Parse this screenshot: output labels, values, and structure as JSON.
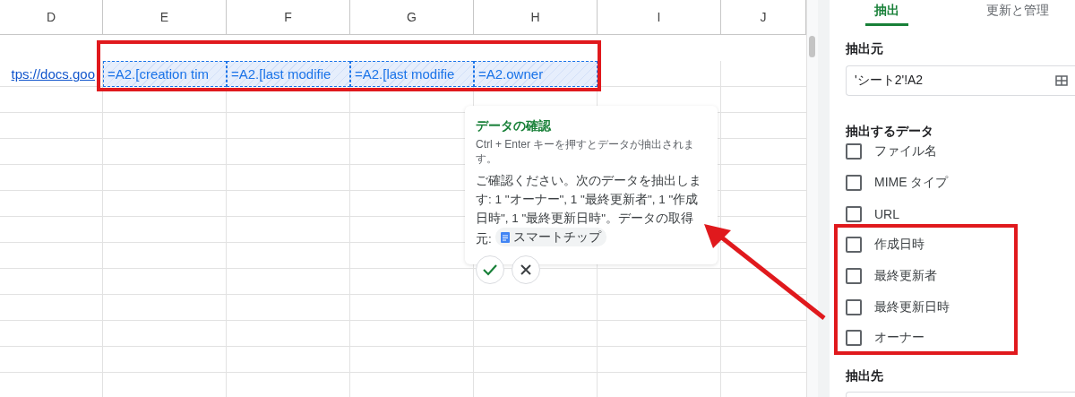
{
  "sheet": {
    "columns": [
      "D",
      "E",
      "F",
      "G",
      "H",
      "I",
      "J"
    ],
    "link_cell": "tps://docs.goo",
    "formula_cells": [
      {
        "text": "=A2.[creation tim",
        "selected": true
      },
      {
        "text": "=A2.[last modifie",
        "selected": true
      },
      {
        "text": "=A2.[last modifie",
        "selected": true
      },
      {
        "text": "=A2.owner",
        "selected": true
      }
    ]
  },
  "popup": {
    "title": "データの確認",
    "hint": "Ctrl + Enter キーを押すとデータが抽出されます。",
    "body": "ご確認ください。次のデータを抽出します: 1 \"オーナー\", 1 \"最終更新者\", 1 \"作成日時\", 1 \"最終更新日時\"。データの取得元:",
    "chip": "スマートチップ"
  },
  "panel": {
    "tabs": [
      {
        "label": "抽出",
        "selected": true
      },
      {
        "label": "更新と管理",
        "selected": false
      }
    ],
    "source_label": "抽出元",
    "source_value": "'シート2'!A2",
    "data_label": "抽出するデータ",
    "options": [
      {
        "label": "ファイル名",
        "checked": false
      },
      {
        "label": "MIME タイプ",
        "checked": false
      },
      {
        "label": "URL",
        "checked": false
      },
      {
        "label": "作成日時",
        "checked": false
      },
      {
        "label": "最終更新者",
        "checked": false
      },
      {
        "label": "最終更新日時",
        "checked": false
      },
      {
        "label": "オーナー",
        "checked": false
      }
    ],
    "destination_label": "抽出先"
  }
}
